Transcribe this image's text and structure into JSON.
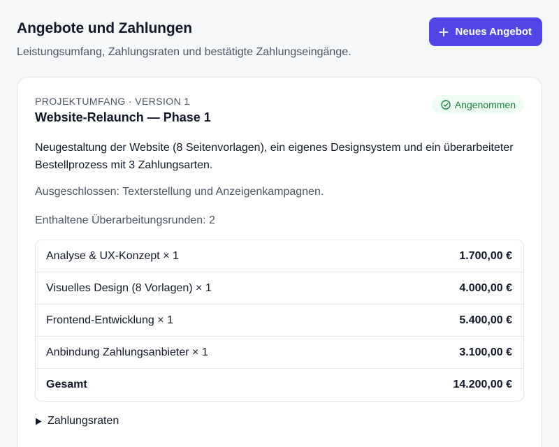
{
  "header": {
    "title": "Angebote und Zahlungen",
    "subtitle": "Leistungsumfang, Zahlungsraten und bestätigte Zahlungseingänge.",
    "new_offer_label": "Neues Angebot"
  },
  "card": {
    "eyebrow": "PROJEKTUMFANG · VERSION 1",
    "title": "Website-Relaunch — Phase 1",
    "status": "Angenommen",
    "description": "Neugestaltung der Website (8 Seitenvorlagen), ein eigenes Designsystem und ein überarbeiteter Bestellprozess mit 3 Zahlungsarten.",
    "excluded": "Ausgeschlossen: Texterstellung und Anzeigenkampagnen.",
    "revisions": "Enthaltene Überarbeitungsrunden: 2",
    "line_items": [
      {
        "label": "Analyse & UX-Konzept × 1",
        "amount": "1.700,00 €"
      },
      {
        "label": "Visuelles Design (8 Vorlagen) × 1",
        "amount": "4.000,00 €"
      },
      {
        "label": "Frontend-Entwicklung × 1",
        "amount": "5.400,00 €"
      },
      {
        "label": "Anbindung Zahlungsanbieter × 1",
        "amount": "3.100,00 €"
      }
    ],
    "total": {
      "label": "Gesamt",
      "amount": "14.200,00 €"
    },
    "installments_label": "Zahlungsraten"
  },
  "colors": {
    "accent": "#4f46e5",
    "status_text": "#15803d",
    "status_bg": "#f0fdf4"
  },
  "icons": {
    "new_offer": "plus-icon",
    "status": "check-circle-icon",
    "installments": "triangle-right-icon"
  }
}
